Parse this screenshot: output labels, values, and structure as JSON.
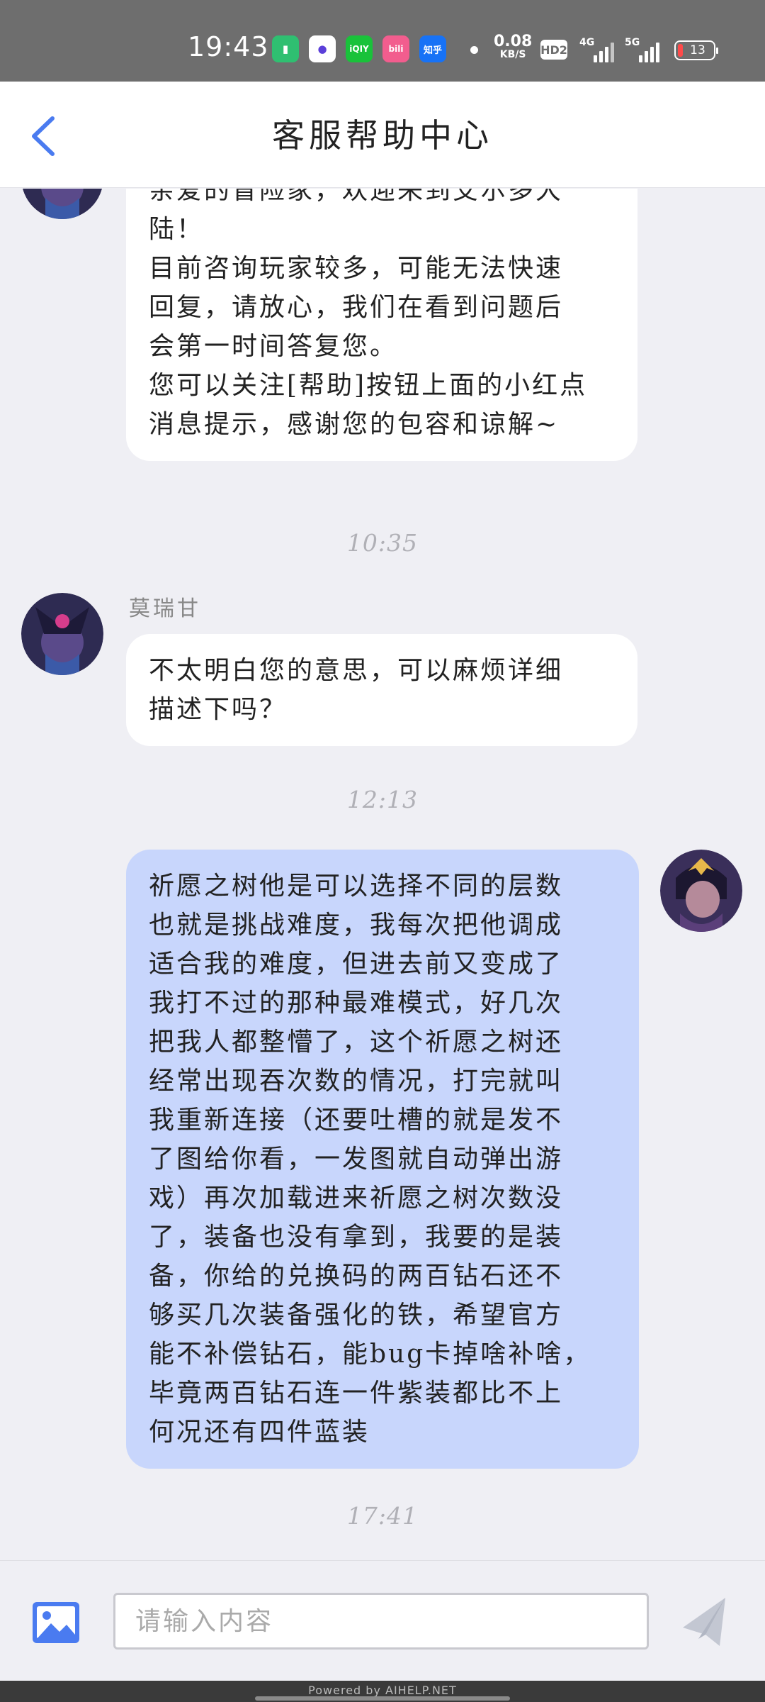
{
  "status_bar": {
    "time": "19:43",
    "network_speed": "0.08",
    "network_unit": "KB/S",
    "hd_label": "HD2",
    "signal1_label": "4G",
    "signal2_label": "5G",
    "battery": "13",
    "apps": [
      {
        "name": "battery-app-icon",
        "glyph": "▮",
        "color": "#2fbf71"
      },
      {
        "name": "browser-app-icon",
        "glyph": "●",
        "color": "#ffffff"
      },
      {
        "name": "iqiyi-app-icon",
        "glyph": "iQIY",
        "color": "#19c23a"
      },
      {
        "name": "bilibili-app-icon",
        "glyph": "bili",
        "color": "#f25d8e"
      },
      {
        "name": "zhihu-app-icon",
        "glyph": "知乎",
        "color": "#1772f6"
      }
    ]
  },
  "header": {
    "title": "客服帮助中心"
  },
  "messages": [
    {
      "type": "incoming",
      "text": "亲爱的冒险家，欢迎来到艾尔多大\n陆！\n目前咨询玩家较多，可能无法快速\n回复，请放心，我们在看到问题后\n会第一时间答复您。\n您可以关注[帮助]按钮上面的小红点\n消息提示，感谢您的包容和谅解~"
    },
    {
      "type": "timestamp",
      "text": "10:35"
    },
    {
      "type": "incoming",
      "sender": "莫瑞甘",
      "text": "不太明白您的意思，可以麻烦详细\n描述下吗？"
    },
    {
      "type": "timestamp",
      "text": "12:13"
    },
    {
      "type": "outgoing",
      "text": "祈愿之树他是可以选择不同的层数\n也就是挑战难度，我每次把他调成\n适合我的难度，但进去前又变成了\n我打不过的那种最难模式，好几次\n把我人都整懵了，这个祈愿之树还\n经常出现吞次数的情况，打完就叫\n我重新连接（还要吐槽的就是发不\n了图给你看，一发图就自动弹出游\n戏）再次加载进来祈愿之树次数没\n了，装备也没有拿到，我要的是装\n备，你给的兑换码的两百钻石还不\n够买几次装备强化的铁，希望官方\n能不补偿钻石，能bug卡掉啥补啥，\n毕竟两百钻石连一件紫装都比不上\n何况还有四件蓝装"
    },
    {
      "type": "timestamp",
      "text": "17:41"
    }
  ],
  "input": {
    "placeholder": "请输入内容",
    "value": ""
  },
  "footer": {
    "powered_by": "Powered by AIHELP.NET"
  },
  "colors": {
    "accent": "#4a7bf0",
    "outgoing_bubble": "#c8d6fc",
    "incoming_bubble": "#ffffff",
    "background": "#efeff4",
    "status_bar": "#6e6e6e",
    "send_icon": "#c3c7d2"
  }
}
